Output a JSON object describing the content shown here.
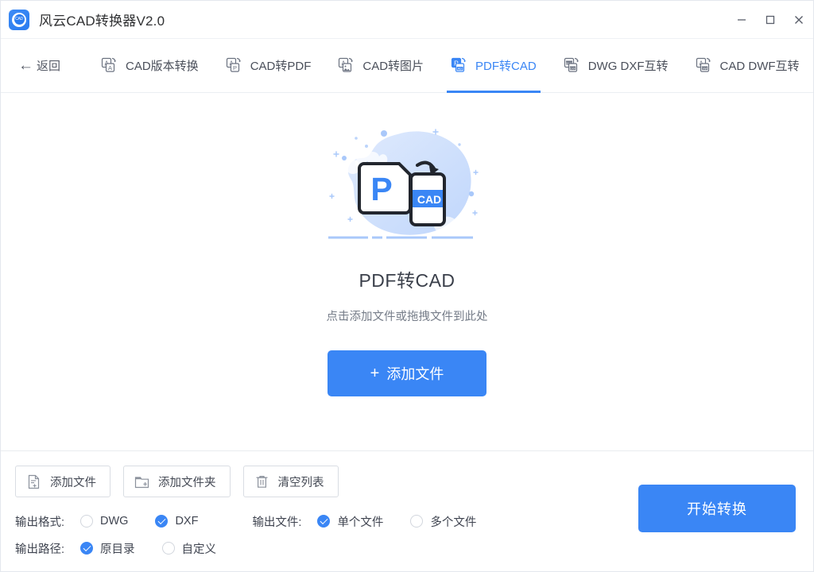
{
  "window": {
    "title": "风云CAD转换器V2.0",
    "logo_text": "CAD",
    "minimize_label": "minimize",
    "maximize_label": "maximize",
    "close_label": "close"
  },
  "nav": {
    "back_label": "返回",
    "back_icon": "arrow-left-icon",
    "tabs": [
      {
        "label": "CAD版本转换",
        "icon": "cad-version-convert-icon",
        "active": false
      },
      {
        "label": "CAD转PDF",
        "icon": "cad-to-pdf-icon",
        "active": false
      },
      {
        "label": "CAD转图片",
        "icon": "cad-to-image-icon",
        "active": false
      },
      {
        "label": "PDF转CAD",
        "icon": "pdf-to-cad-icon",
        "active": true
      },
      {
        "label": "DWG DXF互转",
        "icon": "dwg-dxf-swap-icon",
        "active": false
      },
      {
        "label": "CAD DWF互转",
        "icon": "cad-dwf-swap-icon",
        "active": false
      }
    ]
  },
  "main": {
    "illustration": "pdf-to-cad-illustration",
    "doc_from_letter": "P",
    "doc_to_letter": "CAD",
    "title": "PDF转CAD",
    "subtitle": "点击添加文件或拖拽文件到此处",
    "add_button": "添加文件",
    "add_button_icon": "plus-icon"
  },
  "bottom": {
    "tools": [
      {
        "label": "添加文件",
        "icon": "file-add-icon"
      },
      {
        "label": "添加文件夹",
        "icon": "folder-add-icon"
      },
      {
        "label": "清空列表",
        "icon": "trash-icon"
      }
    ],
    "options": {
      "format_label": "输出格式:",
      "format_choices": [
        {
          "label": "DWG",
          "selected": false
        },
        {
          "label": "DXF",
          "selected": true
        }
      ],
      "output_file_label": "输出文件:",
      "output_file_choices": [
        {
          "label": "单个文件",
          "selected": true
        },
        {
          "label": "多个文件",
          "selected": false
        }
      ],
      "path_label": "输出路径:",
      "path_choices": [
        {
          "label": "原目录",
          "selected": true
        },
        {
          "label": "自定义",
          "selected": false
        }
      ]
    },
    "convert_button": "开始转换"
  },
  "colors": {
    "accent": "#3a86f5",
    "text": "#3f4450",
    "muted": "#757c88",
    "border": "#d9dde3"
  }
}
